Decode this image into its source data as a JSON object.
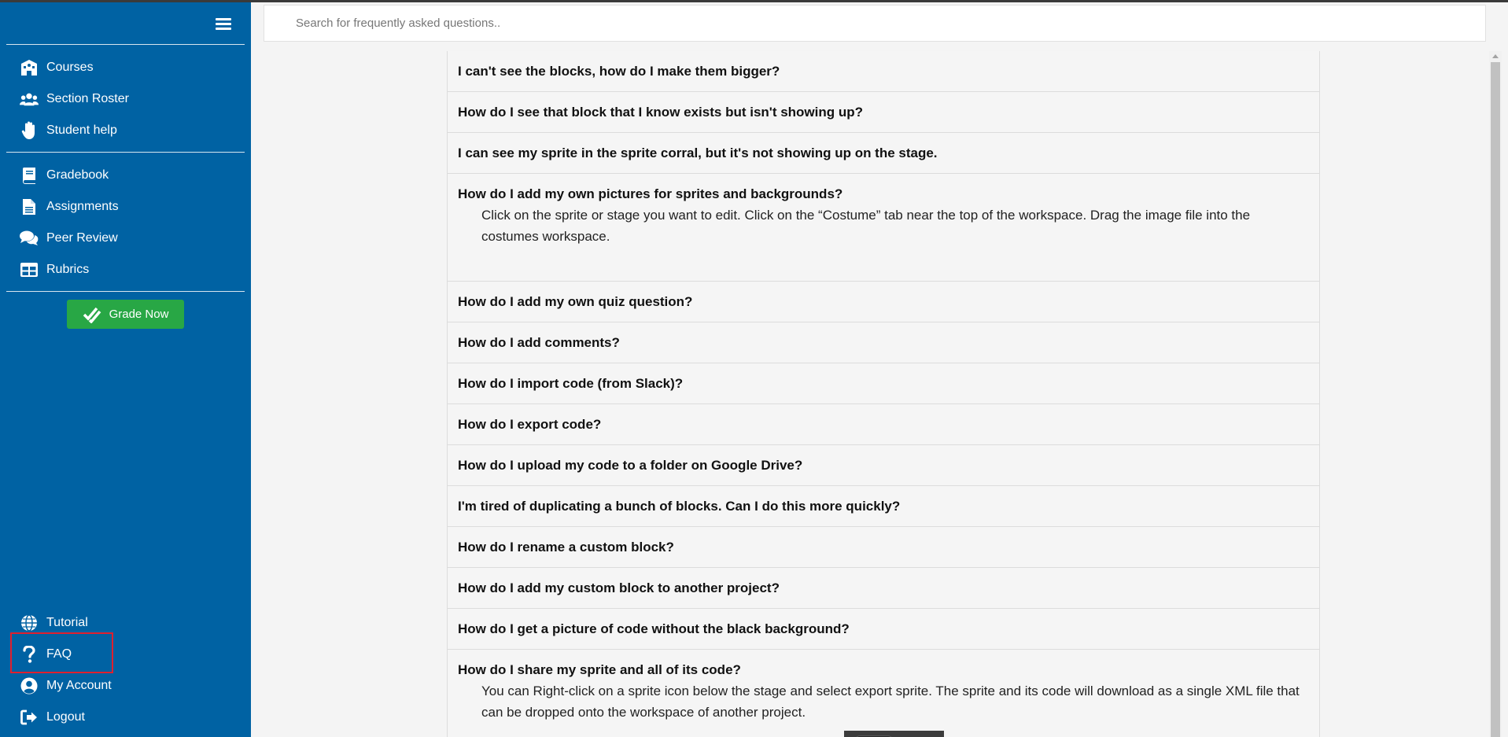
{
  "sidebar": {
    "menu_icon": "hamburger-icon",
    "group1": [
      {
        "label": "Courses",
        "icon": "school-icon"
      },
      {
        "label": "Section Roster",
        "icon": "users-icon"
      },
      {
        "label": "Student help",
        "icon": "raised-hand-icon"
      }
    ],
    "group2": [
      {
        "label": "Gradebook",
        "icon": "book-icon"
      },
      {
        "label": "Assignments",
        "icon": "document-icon"
      },
      {
        "label": "Peer Review",
        "icon": "comments-icon"
      },
      {
        "label": "Rubrics",
        "icon": "table-icon"
      }
    ],
    "grade_now_label": "Grade Now",
    "bottom": [
      {
        "label": "Tutorial",
        "icon": "globe-icon"
      },
      {
        "label": "FAQ",
        "icon": "question-icon",
        "highlighted": true
      },
      {
        "label": "My Account",
        "icon": "user-circle-icon"
      },
      {
        "label": "Logout",
        "icon": "logout-icon"
      }
    ]
  },
  "search": {
    "placeholder": "Search for frequently asked questions.."
  },
  "faq": [
    {
      "q": "I can't see the blocks, how do I make them bigger?"
    },
    {
      "q": "How do I see that block that I know exists but isn't showing up?"
    },
    {
      "q": "I can see my sprite in the sprite corral, but it's not showing up on the stage."
    },
    {
      "q": "How do I add my own pictures for sprites and backgrounds?",
      "a": "Click on the sprite or stage you want to edit. Click on the “Costume” tab near the top of the workspace. Drag the image file into the costumes workspace."
    },
    {
      "q": "How do I add my own quiz question?"
    },
    {
      "q": "How do I add comments?"
    },
    {
      "q": "How do I import code (from Slack)?"
    },
    {
      "q": "How do I export code?"
    },
    {
      "q": "How do I upload my code to a folder on Google Drive?"
    },
    {
      "q": "I'm tired of duplicating a bunch of blocks. Can I do this more quickly?"
    },
    {
      "q": "How do I rename a custom block?"
    },
    {
      "q": "How do I add my custom block to another project?"
    },
    {
      "q": "How do I get a picture of code without the black background?"
    },
    {
      "q": "How do I share my sprite and all of its code?",
      "a": "You can Right-click on a sprite icon below the stage and select export sprite. The sprite and its code will download as a single XML file that can be dropped onto the workspace of another project."
    }
  ]
}
